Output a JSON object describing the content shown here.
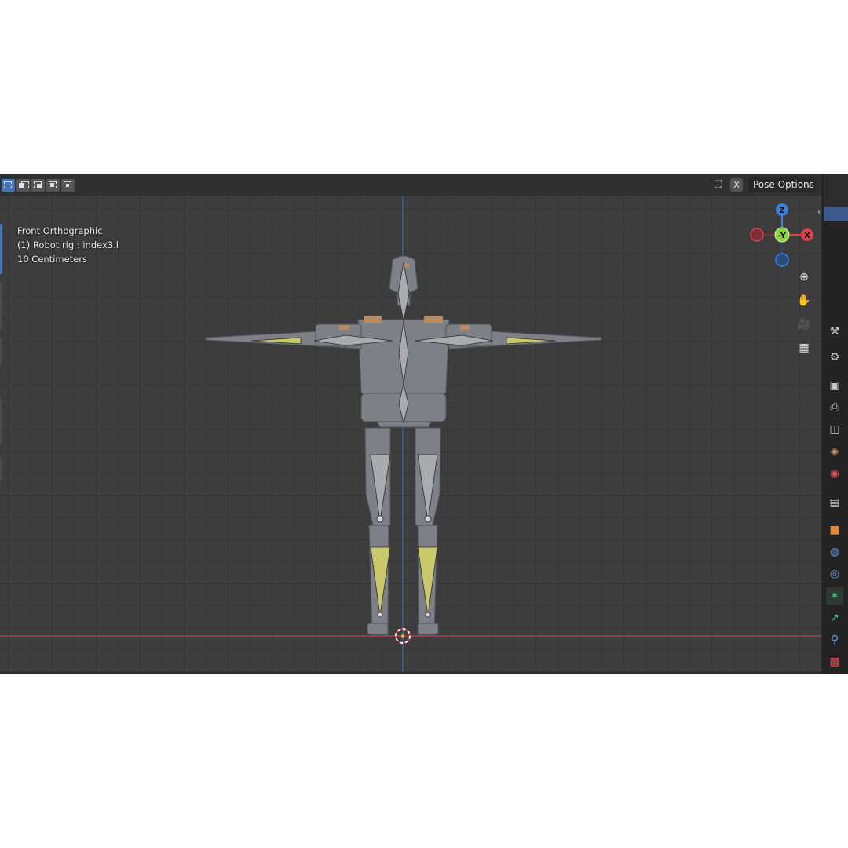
{
  "header": {
    "select_modes": [
      "select-new",
      "select-extend",
      "select-subtract",
      "select-invert",
      "select-intersect"
    ],
    "xray_icon": "xray-icon",
    "x_button": "X",
    "pose_options_label": "Pose Options"
  },
  "viewport": {
    "overlay": {
      "view_name": "Front Orthographic",
      "object_info": "(1) Robot rig : index3.l",
      "scale": "10 Centimeters"
    },
    "gizmo": {
      "axes": {
        "z": "Z",
        "neg_y": "-Y",
        "x": "X"
      },
      "colors": {
        "x": "#e0404a",
        "y": "#8ad53a",
        "z": "#3a82e0",
        "bone_selected": "#c9c86a"
      }
    },
    "nav_buttons": [
      "zoom-icon",
      "pan-hand-icon",
      "camera-icon",
      "grid-ortho-icon"
    ]
  },
  "properties_tabs": [
    "tool-icon",
    "render-icon",
    "output-icon",
    "view-layer-icon",
    "scene-icon",
    "world-icon",
    "collection-icon",
    "object-icon",
    "modifier-icon",
    "physics-icon",
    "object-data-armature-icon",
    "bone-icon",
    "bone-constraint-icon",
    "texture-icon"
  ]
}
